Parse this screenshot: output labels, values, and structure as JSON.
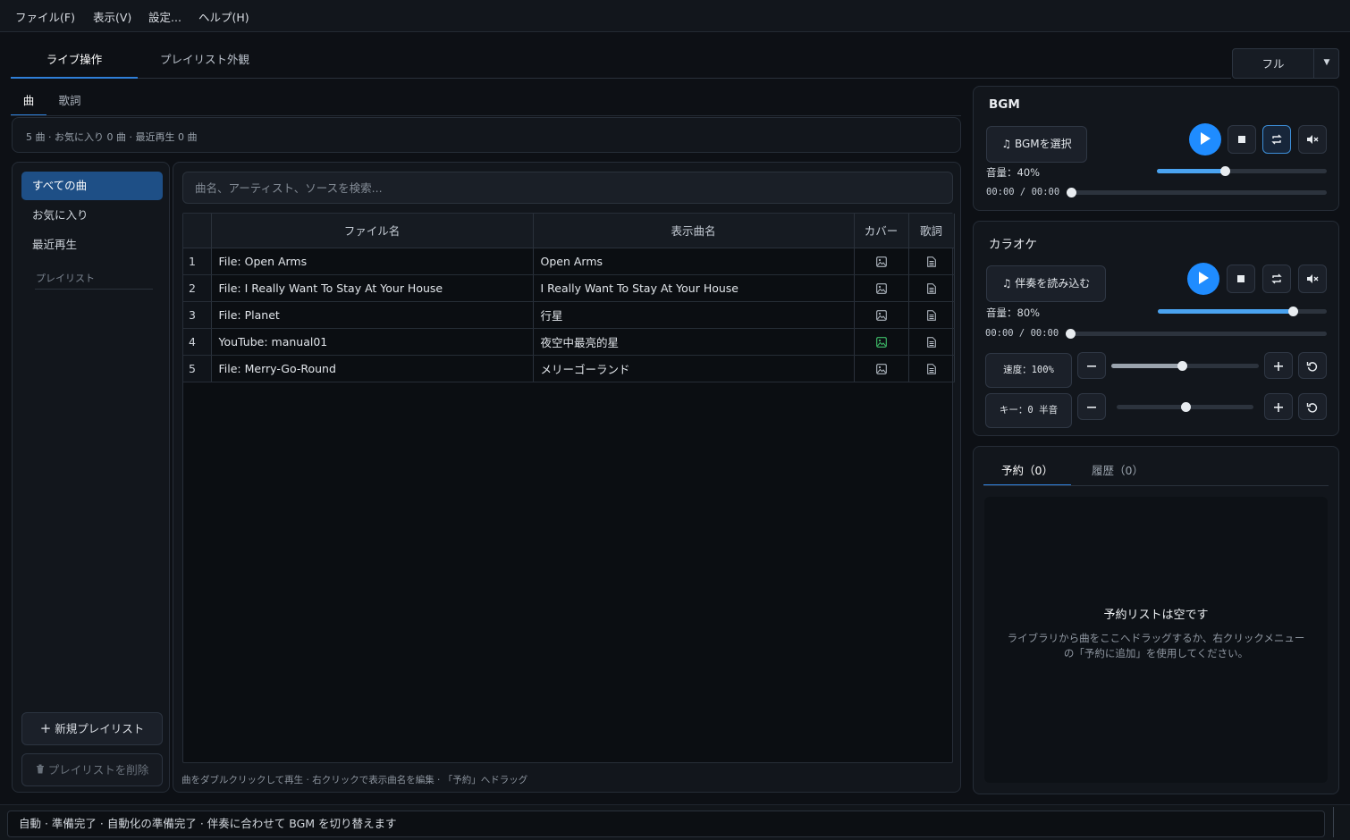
{
  "menu": [
    "ファイル(F)",
    "表示(V)",
    "設定...",
    "ヘルプ(H)"
  ],
  "main_tabs": [
    "ライブ操作",
    "プレイリスト外観"
  ],
  "mode_select": {
    "value": "フル"
  },
  "sub_tabs": [
    "曲",
    "歌詞"
  ],
  "stats": "5 曲 · お気に入り 0 曲 · 最近再生 0 曲",
  "sidebar": {
    "items": [
      "すべての曲",
      "お気に入り",
      "最近再生"
    ],
    "playlist_label": "プレイリスト",
    "new_playlist": "新規プレイリスト",
    "delete_playlist": "プレイリストを削除"
  },
  "search": {
    "placeholder": "曲名、アーティスト、ソースを検索..."
  },
  "table": {
    "columns": [
      "",
      "ファイル名",
      "表示曲名",
      "カバー",
      "歌詞"
    ],
    "rows": [
      {
        "num": "1",
        "file": "File: Open Arms",
        "title": "Open Arms",
        "cover": false
      },
      {
        "num": "2",
        "file": "File: I Really Want To Stay At Your House",
        "title": "I Really Want To Stay At Your House",
        "cover": false
      },
      {
        "num": "3",
        "file": "File: Planet",
        "title": "行星",
        "cover": false
      },
      {
        "num": "4",
        "file": "YouTube: manual01",
        "title": "夜空中最亮的星",
        "cover": true
      },
      {
        "num": "5",
        "file": "File: Merry-Go-Round",
        "title": "メリーゴーランド",
        "cover": false
      }
    ]
  },
  "hint": "曲をダブルクリックして再生 · 右クリックで表示曲名を編集 · 「予約」へドラッグ",
  "bgm": {
    "title": "BGM",
    "select_button": "BGMを選択",
    "volume_label": "音量：40%",
    "volume": 40,
    "time": "00:00 / 00:00",
    "progress": 0
  },
  "karaoke": {
    "title": "カラオケ",
    "load_button": "伴奏を読み込む",
    "volume_label": "音量：80%",
    "volume": 80,
    "time": "00:00 / 00:00",
    "progress": 0,
    "speed_label": "速度：100%",
    "speed_fraction": 0.48,
    "key_label": "キー：0 半音",
    "key_fraction": 0.5
  },
  "queue": {
    "tabs": [
      "予約（0）",
      "履歴（0）"
    ],
    "empty_title": "予約リストは空です",
    "empty_desc": "ライブラリから曲をここへドラッグするか、右クリックメニューの「予約に追加」を使用してください。"
  },
  "status": "自動 · 準備完了 · 自動化の準備完了 · 伴奏に合わせて BGM を切り替えます",
  "colors": {
    "accent": "#1f8cff",
    "active_item": "#1e4f86",
    "cover_present": "#3fbf6a"
  }
}
